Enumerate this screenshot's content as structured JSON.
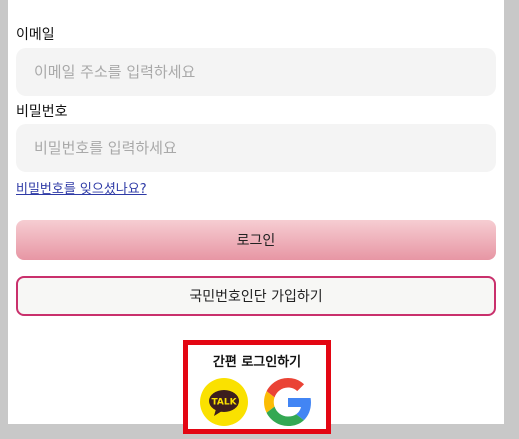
{
  "form": {
    "email_label": "이메일",
    "email_placeholder": "이메일 주소를 입력하세요",
    "password_label": "비밀번호",
    "password_placeholder": "비밀번호를 입력하세요",
    "forgot_password_link": "비밀번호를 잊으셨나요?",
    "login_button": "로그인",
    "signup_button": "국민번호인단 가입하기"
  },
  "social_login": {
    "title": "간편 로그인하기",
    "kakao_icon_text": "TALK",
    "providers": [
      "kakao-talk-icon",
      "google-icon"
    ]
  },
  "colors": {
    "kakao_yellow": "#fae100",
    "kakao_brown": "#3c1e1e",
    "login_gradient_top": "#f6cdd2",
    "login_gradient_bottom": "#e796a4",
    "signup_border": "#c9306c",
    "highlight_red": "#e30613",
    "link_blue": "#2e3aa6"
  }
}
